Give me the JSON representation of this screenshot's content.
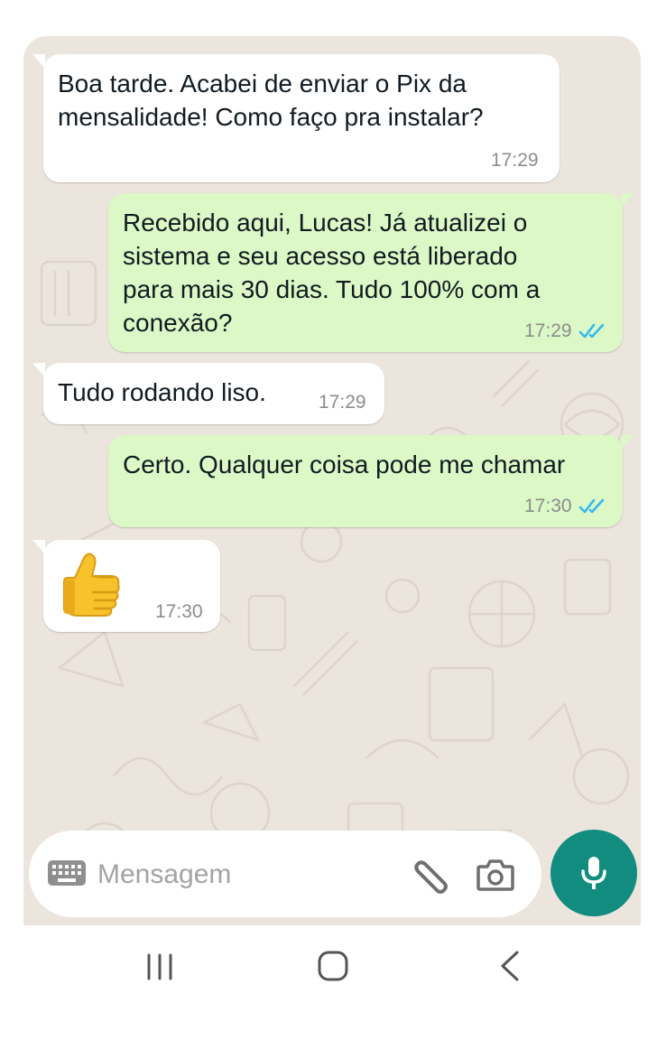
{
  "messages": [
    {
      "direction": "in",
      "text": "Boa tarde. Acabei de enviar o Pix da\nmensalidade! Como faço pra instalar?",
      "time": "17:29"
    },
    {
      "direction": "out",
      "text": "Recebido aqui, Lucas! Já atualizei o\nsistema e seu acesso está liberado\npara mais 30 dias. Tudo 100% com a\nconexão?",
      "time": "17:29",
      "status": "read"
    },
    {
      "direction": "in",
      "text": "Tudo rodando liso.",
      "time": "17:29"
    },
    {
      "direction": "out",
      "text": "Certo. Qualquer coisa pode me chamar",
      "time": "17:30",
      "status": "read"
    },
    {
      "direction": "in",
      "emoji": "thumbs-up",
      "time": "17:30"
    }
  ],
  "composer": {
    "placeholder": "Mensagem",
    "icons": [
      "keyboard-icon",
      "paperclip-icon",
      "camera-icon",
      "microphone-icon"
    ]
  },
  "navigation": {
    "icons": [
      "recent-apps-icon",
      "home-icon",
      "back-icon"
    ]
  },
  "colors": {
    "chat_background": "#ece5dd",
    "incoming_bubble": "#ffffff",
    "outgoing_bubble": "#dcf8c6",
    "read_ticks": "#34b7f1",
    "mic_button": "#128c7e"
  }
}
